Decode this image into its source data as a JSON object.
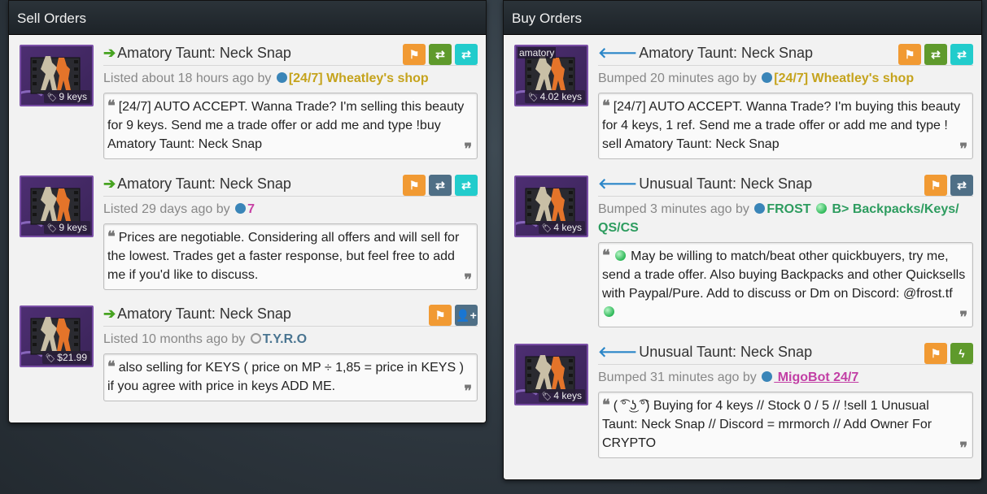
{
  "sell": {
    "title": "Sell Orders",
    "orders": [
      {
        "item": "Amatory Taunt: Neck Snap",
        "price": "9 keys",
        "meta_prefix": "Listed about 18 hours ago by",
        "user": "[24/7] Wheatley's shop",
        "message": "[24/7] AUTO ACCEPT. Wanna Trade? I'm selling this beauty for 9 keys. Send me a trade offer or add me and type !buy Amatory Taunt: Neck Snap"
      },
      {
        "item": "Amatory Taunt: Neck Snap",
        "price": "9 keys",
        "meta_prefix": "Listed 29 days ago by",
        "user": "7",
        "message": "Prices are negotiable. Considering all offers and will sell for the lowest. Trades get a faster response, but feel free to add me if you'd like to discuss."
      },
      {
        "item": "Amatory Taunt: Neck Snap",
        "price": "$21.99",
        "meta_prefix": "Listed 10 months ago by",
        "user": "T.Y.R.O",
        "message": "also selling for KEYS ( price on MP ÷ 1,85 = price in KEYS ) if you agree with price in keys ADD ME."
      }
    ]
  },
  "buy": {
    "title": "Buy Orders",
    "orders": [
      {
        "item": "Amatory Taunt: Neck Snap",
        "price": "4.02 keys",
        "thumb_label": "amatory",
        "meta_prefix": "Bumped 20 minutes ago by",
        "user": "[24/7] Wheatley's shop",
        "message": "[24/7] AUTO ACCEPT. Wanna Trade? I'm buying this beauty for 4 keys, 1 ref. Send me a trade offer or add me and type ! sell Amatory Taunt: Neck Snap"
      },
      {
        "item": "Unusual Taunt: Neck Snap",
        "price": "4 keys",
        "meta_prefix": "Bumped 3 minutes ago by",
        "user_a": "FROST",
        "user_b": "B> Backpacks/Keys/",
        "user_c": "QS/CS",
        "message": "May be willing to match/beat other quickbuyers, try me, send a trade offer. Also buying Backpacks and other Quicksells with Paypal/Pure. Add to discuss or Dm on Discord: @frost.tf"
      },
      {
        "item": "Unusual Taunt: Neck Snap",
        "price": "4 keys",
        "meta_prefix": "Bumped 31 minutes ago by",
        "user": " MigoBot 24/7",
        "message": "( ͡° ͜ʖ ͡°) Buying for 4 keys // Stock 0 / 5 // !sell 1 Unusual Taunt: Neck Snap // Discord = mrmorch // Add Owner For CRYPTO"
      }
    ]
  },
  "icons": {
    "flag": "flag-icon",
    "exchange": "exchange-icon",
    "add_friend": "add-friend-icon",
    "lightning": "lightning-icon",
    "price_tag": "tag-icon"
  },
  "colors": {
    "orange": "#f19a33",
    "green": "#5f9a2c",
    "cyan": "#22cccc",
    "slate": "#4f6f86",
    "sell_arrow": "#47a321",
    "buy_arrow": "#2b86c8"
  }
}
